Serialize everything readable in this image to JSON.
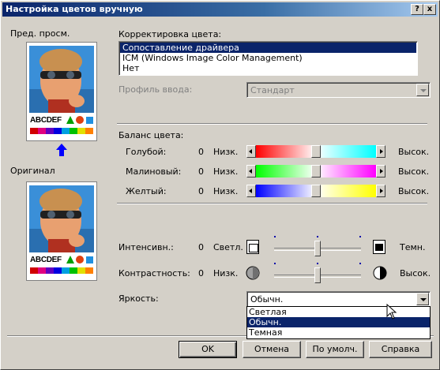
{
  "window": {
    "title": "Настройка цветов вручную",
    "help_btn": "?",
    "close_btn": "x"
  },
  "preview": {
    "label": "Пред. просм.",
    "original_label": "Оригинал",
    "sample_text": "ABCDEF",
    "swatch_colors": [
      "#d00000",
      "#e00080",
      "#6000c0",
      "#0000e0",
      "#00a0e0",
      "#00c000",
      "#e0e000",
      "#ff8000"
    ]
  },
  "color_correction": {
    "label": "Корректировка цвета:",
    "options": [
      "Сопоставление драйвера",
      "ICM (Windows Image Color Management)",
      "Нет"
    ],
    "selected_index": 0
  },
  "input_profile": {
    "label": "Профиль ввода:",
    "value": "Стандарт"
  },
  "color_balance": {
    "label": "Баланс цвета:",
    "rows": [
      {
        "name": "Голубой:",
        "value": "0",
        "low": "Низк.",
        "high": "Высок.",
        "left_color": "#ff0000",
        "right_color": "#00ffff",
        "level": 0.5
      },
      {
        "name": "Малиновый:",
        "value": "0",
        "low": "Низк.",
        "high": "Высок.",
        "left_color": "#00ff00",
        "right_color": "#ff00ff",
        "level": 0.5
      },
      {
        "name": "Желтый:",
        "value": "0",
        "low": "Низк.",
        "high": "Высок.",
        "left_color": "#0000ff",
        "right_color": "#ffff00",
        "level": 0.5
      }
    ]
  },
  "intensity": {
    "label": "Интенсивн.:",
    "value": "0",
    "low": "Светл.",
    "high": "Темн.",
    "level": 0.5
  },
  "contrast": {
    "label": "Контрастность:",
    "value": "0",
    "low": "Низк.",
    "high": "Высок.",
    "level": 0.5
  },
  "brightness": {
    "label": "Яркость:",
    "value": "Обычн.",
    "options": [
      "Светлая",
      "Обычн.",
      "Темная"
    ],
    "selected_index": 1
  },
  "buttons": {
    "ok": "OK",
    "cancel": "Отмена",
    "default": "По умолч.",
    "help": "Справка"
  }
}
